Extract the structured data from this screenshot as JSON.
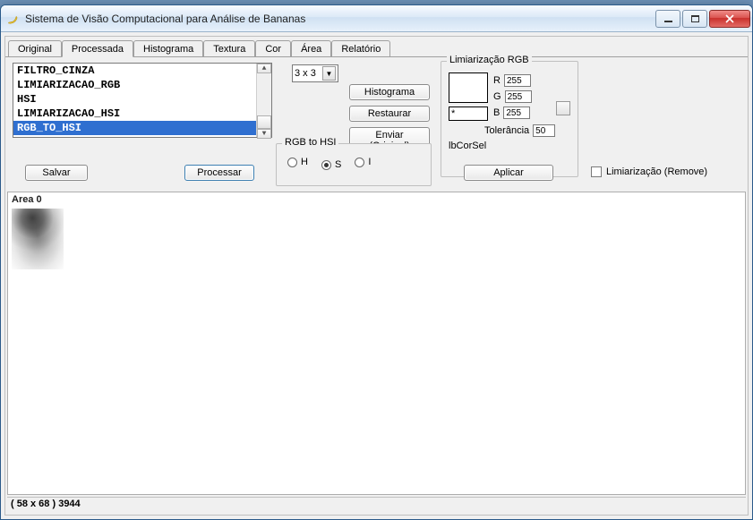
{
  "window": {
    "title": "Sistema de Visão Computacional para Análise de Bananas"
  },
  "tabs": {
    "items": [
      "Original",
      "Processada",
      "Histograma",
      "Textura",
      "Cor",
      "Área",
      "Relatório"
    ],
    "active": 1
  },
  "filters": {
    "items": [
      "FILTRO_CINZA",
      "LIMIARIZACAO_RGB",
      "HSI",
      "LIMIARIZACAO_HSI",
      "RGB_TO_HSI"
    ],
    "selected": 4
  },
  "buttons": {
    "salvar": "Salvar",
    "processar": "Processar",
    "histograma": "Histograma",
    "restaurar": "Restaurar",
    "enviar": "Enviar (Original)",
    "aplicar": "Aplicar"
  },
  "kernel": {
    "value": "3 x 3"
  },
  "rgb_to_hsi": {
    "caption": "RGB to HSI",
    "options": {
      "h": "H",
      "s": "S",
      "i": "I"
    },
    "selected": "s"
  },
  "limiar": {
    "caption": "Limiarização RGB",
    "r_label": "R",
    "r": "255",
    "g_label": "G",
    "g": "255",
    "b_label": "B",
    "b": "255",
    "box1_text": "",
    "box2_text": "*",
    "tol_label": "Tolerância",
    "tol": "50",
    "isel_label": "lbCorSel"
  },
  "remove_checkbox": {
    "label": "Limiarização (Remove)",
    "checked": false
  },
  "preview": {
    "area_label": "Area  0"
  },
  "status": {
    "text": "( 58 x 68 ) 3944"
  }
}
